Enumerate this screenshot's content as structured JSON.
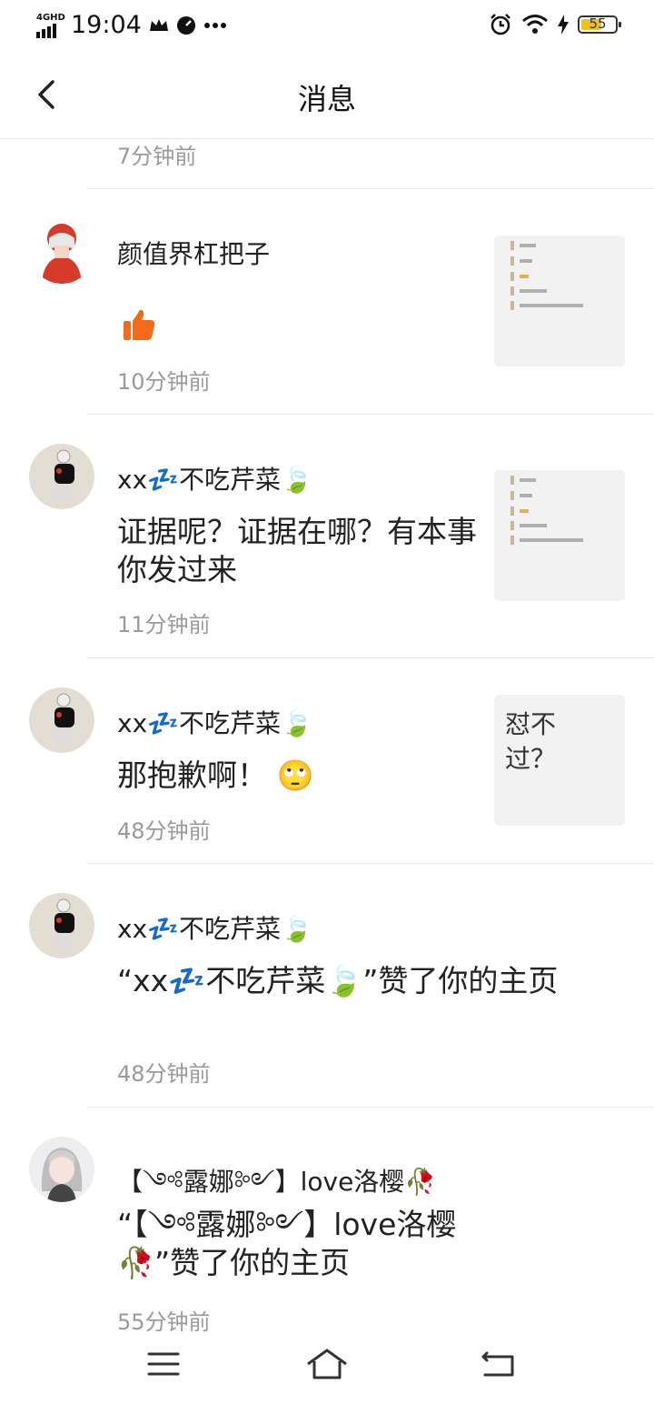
{
  "status_bar": {
    "network": "4GHD",
    "time": "19:04",
    "battery": "55"
  },
  "header": {
    "title": "消息"
  },
  "top_time": "7分钟前",
  "messages": [
    {
      "name": "颜值界杠把子",
      "text": "",
      "reaction": "thumbs-up-icon",
      "time": "10分钟前",
      "preview": "thumbnail"
    },
    {
      "name": "xx💤不吃芹菜🍃",
      "text": "证据呢？证据在哪？有本事你发过来",
      "time": "11分钟前",
      "preview": "thumbnail"
    },
    {
      "name": "xx💤不吃芹菜🍃",
      "text": "那抱歉啊！ 🙄",
      "time": "48分钟前",
      "preview_text": "怼不过？"
    },
    {
      "name": "xx💤不吃芹菜🍃",
      "text": "“xx💤不吃芹菜🍃”赞了你的主页",
      "time": "48分钟前"
    },
    {
      "name": "【༺露娜༻】love洛樱🥀",
      "text": "“【༺露娜༻】love洛樱🥀”赞了你的主页",
      "time": "55分钟前"
    }
  ],
  "colors": {
    "accent_orange": "#f26b1d",
    "muted_text": "#9a9a9a"
  }
}
